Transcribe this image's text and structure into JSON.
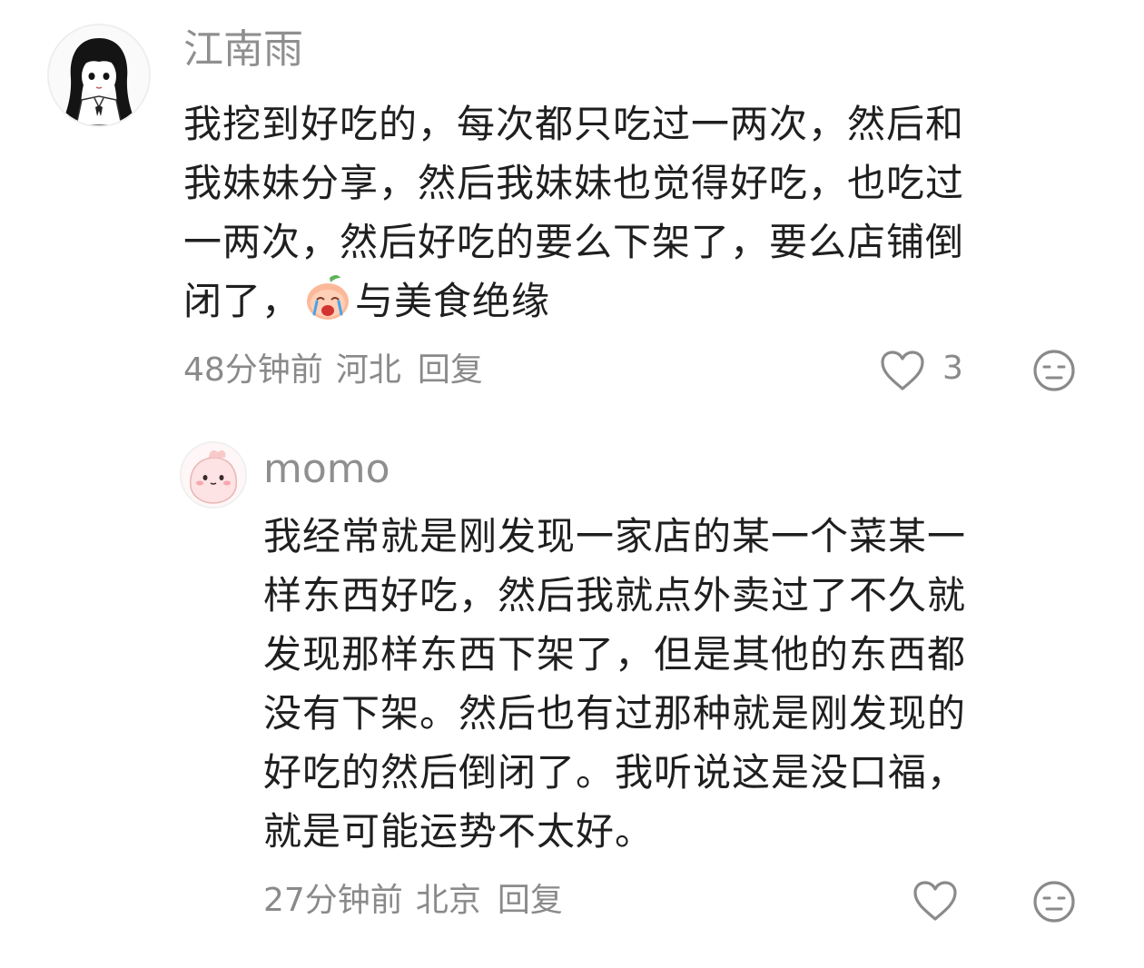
{
  "comments": [
    {
      "username": "江南雨",
      "avatar_icon": "girl-sketch-avatar-icon",
      "lines": [
        "我挖到好吃的，每次都只吃过一两次，然后和",
        "我妹妹分享，然后我妹妹也觉得好吃，也吃过",
        "一两次，然后好吃的要么下架了，要么店铺倒"
      ],
      "last_line_prefix": "闭了，",
      "inline_emoji": "crying-peach-emoji-icon",
      "last_line_suffix": "与美食绝缘",
      "time": "48分钟前",
      "location": "河北",
      "reply_label": "回复",
      "like_count": "3",
      "like_icon": "heart-outline-icon",
      "dislike_icon": "meh-face-icon"
    },
    {
      "username": "momo",
      "avatar_icon": "pink-bunny-avatar-icon",
      "lines": [
        "我经常就是刚发现一家店的某一个菜某一",
        "样东西好吃，然后我就点外卖过了不久就",
        "发现那样东西下架了，但是其他的东西都",
        "没有下架。然后也有过那种就是刚发现的",
        "好吃的然后倒闭了。我听说这是没口福，",
        "就是可能运势不太好。"
      ],
      "time": "27分钟前",
      "location": "北京",
      "reply_label": "回复",
      "like_count": "",
      "like_icon": "heart-outline-icon",
      "dislike_icon": "meh-face-icon"
    }
  ],
  "colors": {
    "text": "#1f1f1f",
    "meta": "#8a8a8a",
    "username": "#8f8f8f",
    "background": "#ffffff"
  }
}
